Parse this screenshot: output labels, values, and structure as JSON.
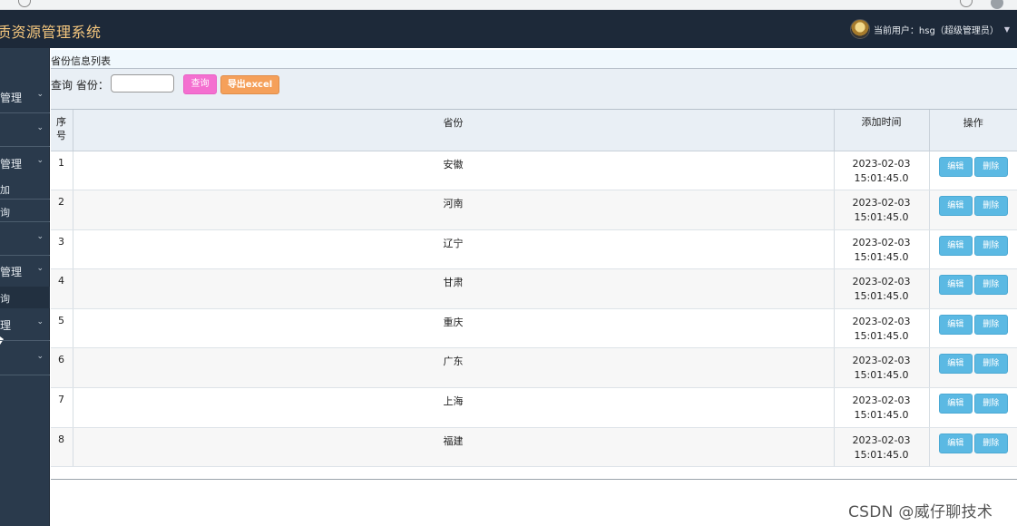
{
  "header": {
    "system_title": "质资源管理系统",
    "user_label": "当前用户：hsg（超级管理员）"
  },
  "sidebar": {
    "items": [
      {
        "label": "管理"
      },
      {
        "label": ""
      },
      {
        "label": "管理"
      },
      {
        "label": ""
      },
      {
        "label": "管理"
      },
      {
        "label": "理"
      },
      {
        "label": ""
      }
    ],
    "subitems": [
      {
        "label": "加"
      },
      {
        "label": "询"
      },
      {
        "label": "询"
      }
    ]
  },
  "panel": {
    "title": "省份信息列表"
  },
  "toolbar": {
    "query_label": "查询 省份：",
    "query_value": "",
    "search_button": "查询",
    "export_button": "导出excel"
  },
  "table": {
    "headers": {
      "no_line1": "序",
      "no_line2": "号",
      "province": "省份",
      "time": "添加时间",
      "actions": "操作"
    },
    "edit_label": "编辑",
    "delete_label": "删除",
    "rows": [
      {
        "no": "1",
        "province": "安徽",
        "date": "2023-02-03",
        "time": "15:01:45.0"
      },
      {
        "no": "2",
        "province": "河南",
        "date": "2023-02-03",
        "time": "15:01:45.0"
      },
      {
        "no": "3",
        "province": "辽宁",
        "date": "2023-02-03",
        "time": "15:01:45.0"
      },
      {
        "no": "4",
        "province": "甘肃",
        "date": "2023-02-03",
        "time": "15:01:45.0"
      },
      {
        "no": "5",
        "province": "重庆",
        "date": "2023-02-03",
        "time": "15:01:45.0"
      },
      {
        "no": "6",
        "province": "广东",
        "date": "2023-02-03",
        "time": "15:01:45.0"
      },
      {
        "no": "7",
        "province": "上海",
        "date": "2023-02-03",
        "time": "15:01:45.0"
      },
      {
        "no": "8",
        "province": "福建",
        "date": "2023-02-03",
        "time": "15:01:45.0"
      }
    ]
  },
  "watermark": "CSDN @威仔聊技术"
}
